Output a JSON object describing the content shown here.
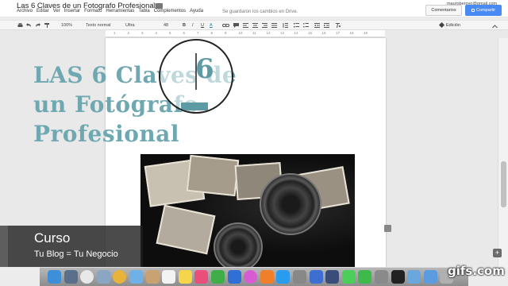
{
  "title_bar": {
    "doc_title": "Las 6 Claves de un Fotografo Profesional",
    "user_email": "mauroberovo@gmail.com"
  },
  "menu_bar": {
    "items": [
      "Archivo",
      "Editar",
      "Ver",
      "Insertar",
      "Formato",
      "Herramientas",
      "Tabla",
      "Complementos",
      "Ayuda"
    ],
    "save_status": "Se guardaron los cambios en Drive.",
    "comments_label": "Comentarios",
    "share_label": "Compartir"
  },
  "toolbar": {
    "zoom": "100%",
    "style": "Texto normal",
    "font": "Ultra",
    "font_size": "48",
    "mode": "Edición"
  },
  "ruler": {
    "numbers": [
      "1",
      "2",
      "3",
      "4",
      "5",
      "6",
      "7",
      "8",
      "9",
      "10",
      "11",
      "12",
      "13",
      "14",
      "15",
      "16",
      "17",
      "18",
      "19"
    ]
  },
  "document": {
    "headline_line_1": "LAS 6 Claves de",
    "headline_line_2": "un Fotógrafo",
    "headline_line_3": "Profesional"
  },
  "magnifier": {
    "text": "6"
  },
  "overlay": {
    "title": "Curso",
    "subtitle": "Tu Blog = Tu Negocio"
  },
  "watermark": "gifs.com",
  "colors": {
    "headline": "#6fa8b0",
    "share_button": "#4a8af4"
  },
  "dock": {
    "icons": [
      "finder-icon",
      "launchpad-icon",
      "safari-icon",
      "rocket-icon",
      "chrome-icon",
      "mail-icon",
      "contacts-icon",
      "calendar-icon",
      "notes-icon",
      "photos-icon",
      "numbers-icon",
      "keynote-icon",
      "itunes-icon",
      "ibooks-icon",
      "appstore-icon",
      "preferences-icon",
      "screen-icon",
      "quicktime-icon",
      "messages-icon",
      "facetime-icon",
      "settings-icon",
      "terminal-icon",
      "folder-icon",
      "downloads-icon",
      "trash-icon"
    ]
  }
}
